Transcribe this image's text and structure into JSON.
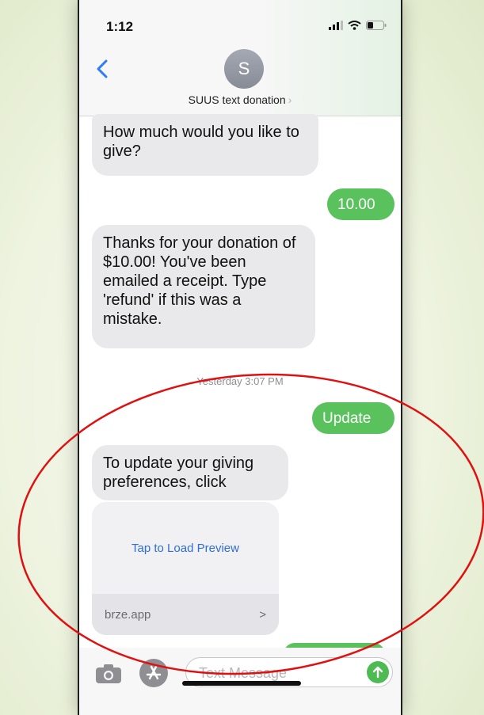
{
  "status": {
    "time": "1:12"
  },
  "header": {
    "avatar_initial": "S",
    "contact_name": "SUUS text donation",
    "contact_chevron": "›"
  },
  "messages": [
    {
      "direction": "incoming",
      "text": "How much would you like to give?"
    },
    {
      "direction": "outgoing",
      "text": "10.00"
    },
    {
      "direction": "incoming",
      "text": "Thanks for your donation of $10.00!  You've been emailed a receipt.  Type 'refund' if this was a mistake."
    },
    {
      "direction": "outgoing",
      "text": "Update"
    },
    {
      "direction": "incoming",
      "text": "To update your giving preferences, click"
    }
  ],
  "timestamp": "Yesterday 3:07 PM",
  "link_preview": {
    "action": "Tap to Load Preview",
    "domain": "brze.app",
    "chevron": ">"
  },
  "composer": {
    "placeholder": "Text Message"
  },
  "icons": {
    "back": "chevron-left-icon",
    "camera": "camera-icon",
    "app_store": "app-store-icon",
    "send": "send-arrow-icon",
    "signal": "signal-icon",
    "wifi": "wifi-icon",
    "battery": "battery-icon"
  },
  "colors": {
    "accent_blue": "#2f7cf6",
    "bubble_green": "#5ac25d",
    "bubble_gray": "#e9e9eb",
    "annotation_red": "#e01010"
  }
}
